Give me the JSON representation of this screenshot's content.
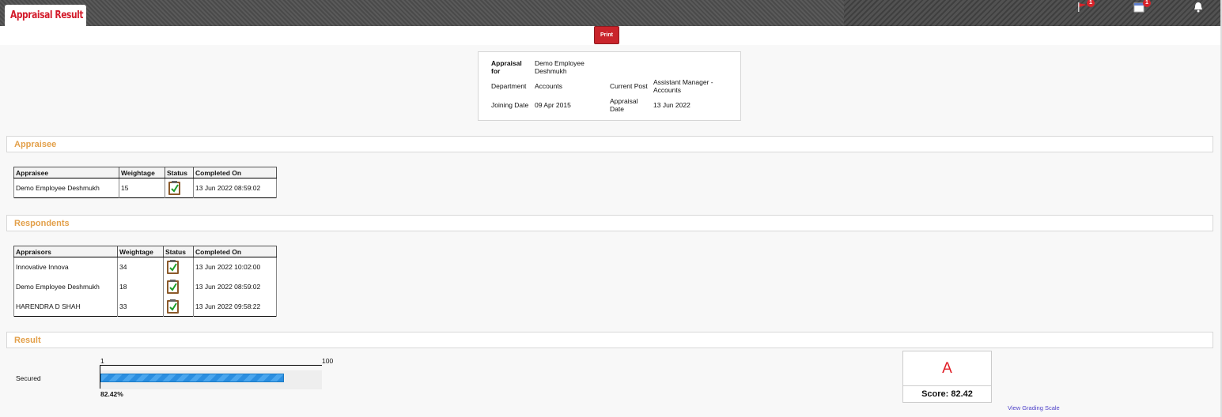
{
  "app": {
    "title": "Appraisal Result",
    "print_label": "Print",
    "notifications": [
      {
        "icon": "flag-icon",
        "badge": "1"
      },
      {
        "icon": "calendar-icon",
        "badge": "1"
      },
      {
        "icon": "bell-icon",
        "badge": ""
      }
    ]
  },
  "info": {
    "appraisal_for_label": "Appraisal for",
    "appraisal_for_value": "Demo Employee Deshmukh",
    "department_label": "Department",
    "department_value": "Accounts",
    "current_post_label": "Current Post",
    "current_post_value": "Assistant Manager - Accounts",
    "joining_date_label": "Joining Date",
    "joining_date_value": "09 Apr 2015",
    "appraisal_date_label": "Appraisal Date",
    "appraisal_date_value": "13 Jun 2022"
  },
  "appraisee": {
    "section_title": "Appraisee",
    "columns": [
      "Appraisee",
      "Weightage",
      "Status",
      "Completed On"
    ],
    "rows": [
      {
        "name": "Demo Employee Deshmukh",
        "weightage": "15",
        "status": "completed",
        "completed_on": "13 Jun 2022 08:59:02"
      }
    ]
  },
  "respondents": {
    "section_title": "Respondents",
    "columns": [
      "Appraisors",
      "Weightage",
      "Status",
      "Completed On"
    ],
    "rows": [
      {
        "name": "Innovative Innova",
        "weightage": "34",
        "status": "completed",
        "completed_on": "13 Jun 2022 10:02:00"
      },
      {
        "name": "Demo Employee Deshmukh",
        "weightage": "18",
        "status": "completed",
        "completed_on": "13 Jun 2022 08:59:02"
      },
      {
        "name": "HARENDRA D SHAH",
        "weightage": "33",
        "status": "completed",
        "completed_on": "13 Jun 2022 09:58:22"
      }
    ]
  },
  "result": {
    "section_title": "Result",
    "secured_label": "Secured",
    "scale_min": "1",
    "scale_max": "100",
    "secured_percent": 82.42,
    "secured_percent_label": "82.42%",
    "grade": "A",
    "score_label": "Score: 82.42",
    "grading_scale_link": "View Grading Scale"
  },
  "colors": {
    "accent": "#d31b2b",
    "section_title": "#e3a04a",
    "progress": "#2b8ee0",
    "link": "#4c3fc8"
  }
}
